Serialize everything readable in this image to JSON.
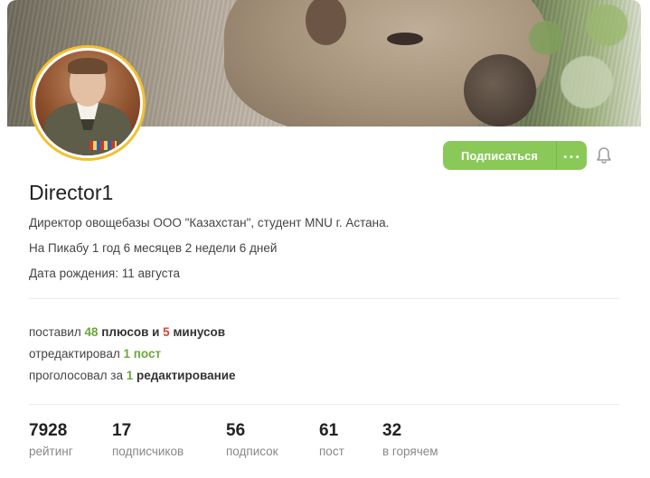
{
  "profile": {
    "username": "Director1",
    "bio": "Директор овощебазы ООО \"Казахстан\", студент MNU г. Астана.",
    "membership": "На Пикабу 1 год 6 месяцев 2 недели 6 дней",
    "birthday": "Дата рождения: 11 августа"
  },
  "actions": {
    "subscribe_label": "Подписаться",
    "more_label": "•••",
    "bell_icon": "bell-icon"
  },
  "activity": {
    "line1": {
      "prefix": "поставил ",
      "pluses": "48",
      "mid": " плюсов и ",
      "minuses": "5",
      "suffix": " минусов"
    },
    "line2": {
      "prefix": "отредактировал ",
      "count": "1",
      "suffix": " пост"
    },
    "line3": {
      "prefix": "проголосовал за ",
      "count": "1",
      "suffix": " редактирование"
    }
  },
  "stats": [
    {
      "value": "7928",
      "label": "рейтинг"
    },
    {
      "value": "17",
      "label": "подписчиков"
    },
    {
      "value": "56",
      "label": "подписок"
    },
    {
      "value": "61",
      "label": "пост"
    },
    {
      "value": "32",
      "label": "в горячем"
    }
  ],
  "colors": {
    "accent": "#8ac858",
    "plus": "#6aa83c",
    "minus": "#d34536",
    "avatar_ring": "#f2c12e"
  }
}
